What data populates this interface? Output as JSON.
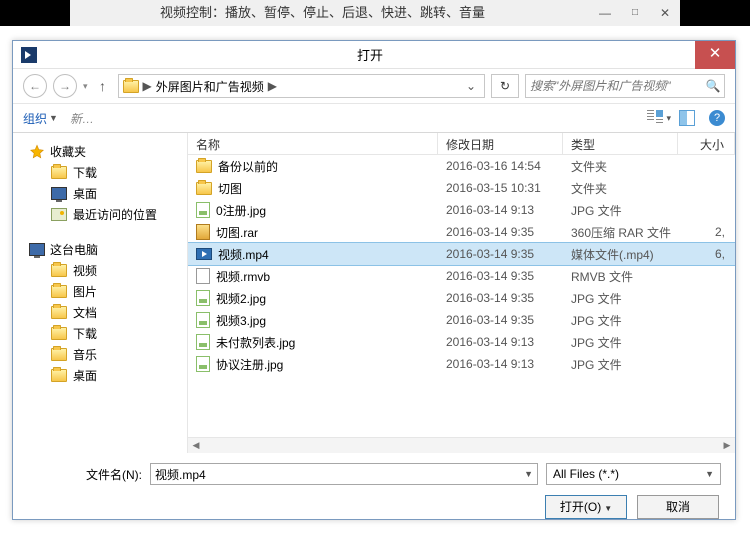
{
  "parent_window": {
    "title": "视频控制：播放、暂停、停止、后退、快进、跳转、音量",
    "minimize": "—",
    "maximize": "□",
    "close": "✕"
  },
  "dialog": {
    "title": "打开",
    "close": "✕"
  },
  "nav": {
    "back": "←",
    "forward": "→",
    "up": "↑",
    "breadcrumb_sep1": "▶",
    "breadcrumb_folder": "外屏图片和广告视频",
    "breadcrumb_sep2": "▶",
    "crumb_drop": "⌄",
    "refresh": "↻",
    "search_placeholder": "搜索\"外屏图片和广告视频\"",
    "search_icon": "🔍"
  },
  "toolbar": {
    "organize": "组织",
    "newfolder_partial": "新…",
    "view_drop": "▾",
    "help": "?"
  },
  "sidebar": {
    "favorites": {
      "label": "收藏夹",
      "items": [
        "下载",
        "桌面",
        "最近访问的位置"
      ]
    },
    "thispc": {
      "label": "这台电脑",
      "items": [
        "视频",
        "图片",
        "文档",
        "下载",
        "音乐",
        "桌面"
      ]
    }
  },
  "columns": {
    "name": "名称",
    "date": "修改日期",
    "type": "类型",
    "size": "大小"
  },
  "files": [
    {
      "name": "备份以前的",
      "date": "2016-03-16 14:54",
      "type": "文件夹",
      "size": "",
      "icon": "folder",
      "selected": false
    },
    {
      "name": "切图",
      "date": "2016-03-15 10:31",
      "type": "文件夹",
      "size": "",
      "icon": "folder",
      "selected": false
    },
    {
      "name": "0注册.jpg",
      "date": "2016-03-14 9:13",
      "type": "JPG 文件",
      "size": "",
      "icon": "jpg",
      "selected": false
    },
    {
      "name": "切图.rar",
      "date": "2016-03-14 9:35",
      "type": "360压缩 RAR 文件",
      "size": "2,",
      "icon": "rar",
      "selected": false
    },
    {
      "name": "视频.mp4",
      "date": "2016-03-14 9:35",
      "type": "媒体文件(.mp4)",
      "size": "6,",
      "icon": "mp4",
      "selected": true
    },
    {
      "name": "视频.rmvb",
      "date": "2016-03-14 9:35",
      "type": "RMVB 文件",
      "size": "",
      "icon": "rm",
      "selected": false
    },
    {
      "name": "视频2.jpg",
      "date": "2016-03-14 9:35",
      "type": "JPG 文件",
      "size": "",
      "icon": "jpg",
      "selected": false
    },
    {
      "name": "视频3.jpg",
      "date": "2016-03-14 9:35",
      "type": "JPG 文件",
      "size": "",
      "icon": "jpg",
      "selected": false
    },
    {
      "name": "未付款列表.jpg",
      "date": "2016-03-14 9:13",
      "type": "JPG 文件",
      "size": "",
      "icon": "jpg",
      "selected": false
    },
    {
      "name": "协议注册.jpg",
      "date": "2016-03-14 9:13",
      "type": "JPG 文件",
      "size": "",
      "icon": "jpg",
      "selected": false
    }
  ],
  "bottom": {
    "filename_label": "文件名(N):",
    "filename_value": "视频.mp4",
    "filter_value": "All Files (*.*)",
    "open_label": "打开(O)",
    "cancel_label": "取消"
  }
}
